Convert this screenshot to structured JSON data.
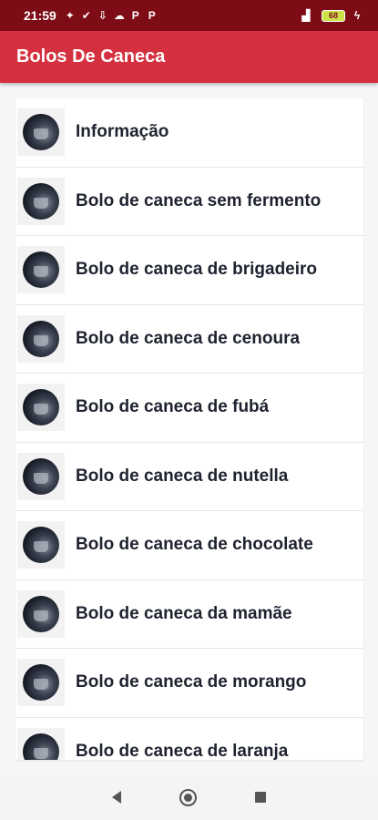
{
  "status_bar": {
    "time": "21:59",
    "battery": "68",
    "icons": [
      "app-notification-icon",
      "check-badge-icon",
      "download-icon",
      "cloud-icon",
      "p-app-icon",
      "p-app-icon"
    ]
  },
  "app_bar": {
    "title": "Bolos De Caneca",
    "color": "#d4303f",
    "status_color": "#7e0c16"
  },
  "list": {
    "items": [
      {
        "label": "Informação"
      },
      {
        "label": "Bolo de caneca sem fermento"
      },
      {
        "label": "Bolo de caneca de brigadeiro"
      },
      {
        "label": "Bolo de caneca de cenoura"
      },
      {
        "label": "Bolo de caneca de fubá"
      },
      {
        "label": "Bolo de caneca de nutella"
      },
      {
        "label": "Bolo de caneca de chocolate"
      },
      {
        "label": "Bolo de caneca da mamãe"
      },
      {
        "label": "Bolo de caneca de morango"
      },
      {
        "label": "Bolo de caneca de laranja"
      }
    ]
  },
  "nav_bar": {
    "icons": [
      "back-icon",
      "home-icon",
      "recent-apps-icon"
    ]
  }
}
